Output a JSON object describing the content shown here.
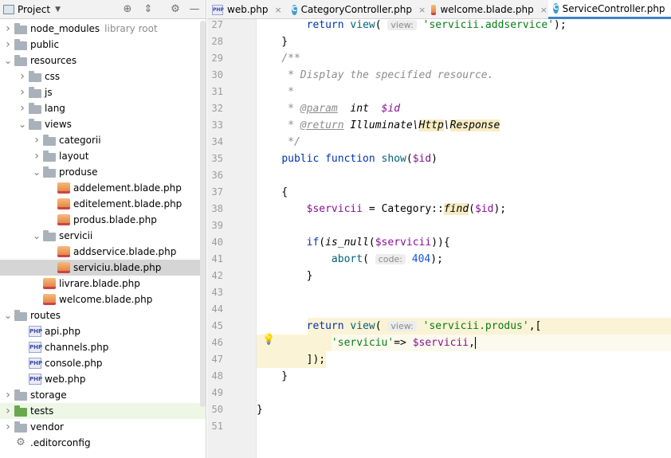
{
  "project_panel": {
    "title": "Project",
    "tree": [
      {
        "label": "node_modules",
        "suffix": "library root",
        "type": "folder",
        "depth": 1,
        "expanded": false
      },
      {
        "label": "public",
        "type": "folder",
        "depth": 1,
        "expanded": false
      },
      {
        "label": "resources",
        "type": "folder",
        "depth": 1,
        "expanded": true
      },
      {
        "label": "css",
        "type": "folder",
        "depth": 2,
        "expanded": false
      },
      {
        "label": "js",
        "type": "folder",
        "depth": 2,
        "expanded": false
      },
      {
        "label": "lang",
        "type": "folder",
        "depth": 2,
        "expanded": false
      },
      {
        "label": "views",
        "type": "folder",
        "depth": 2,
        "expanded": true
      },
      {
        "label": "categorii",
        "type": "folder",
        "depth": 3,
        "expanded": false
      },
      {
        "label": "layout",
        "type": "folder",
        "depth": 3,
        "expanded": false
      },
      {
        "label": "produse",
        "type": "folder",
        "depth": 3,
        "expanded": true
      },
      {
        "label": "addelement.blade.php",
        "type": "blade",
        "depth": 4
      },
      {
        "label": "editelement.blade.php",
        "type": "blade",
        "depth": 4
      },
      {
        "label": "produs.blade.php",
        "type": "blade",
        "depth": 4
      },
      {
        "label": "servicii",
        "type": "folder",
        "depth": 3,
        "expanded": true
      },
      {
        "label": "addservice.blade.php",
        "type": "blade",
        "depth": 4
      },
      {
        "label": "serviciu.blade.php",
        "type": "blade",
        "depth": 4,
        "selected": true
      },
      {
        "label": "livrare.blade.php",
        "type": "blade",
        "depth": 3
      },
      {
        "label": "welcome.blade.php",
        "type": "blade",
        "depth": 3
      },
      {
        "label": "routes",
        "type": "folder",
        "depth": 1,
        "expanded": true
      },
      {
        "label": "api.php",
        "type": "php",
        "depth": 2
      },
      {
        "label": "channels.php",
        "type": "php",
        "depth": 2
      },
      {
        "label": "console.php",
        "type": "php",
        "depth": 2
      },
      {
        "label": "web.php",
        "type": "php",
        "depth": 2
      },
      {
        "label": "storage",
        "type": "folder",
        "depth": 1,
        "expanded": false
      },
      {
        "label": "tests",
        "type": "folder-green",
        "depth": 1,
        "expanded": false
      },
      {
        "label": "vendor",
        "type": "folder",
        "depth": 1,
        "expanded": false
      },
      {
        "label": ".editorconfig",
        "type": "config",
        "depth": 1
      }
    ]
  },
  "tabs": [
    {
      "label": "web.php",
      "icon": "php-file-icon",
      "active": false
    },
    {
      "label": "CategoryController.php",
      "icon": "class-icon",
      "active": false
    },
    {
      "label": "welcome.blade.php",
      "icon": "blade-file-icon",
      "active": false
    },
    {
      "label": "ServiceController.php",
      "icon": "class-icon",
      "active": true
    }
  ],
  "editor": {
    "line_numbers": [
      "27",
      "28",
      "29",
      "30",
      "31",
      "32",
      "33",
      "34",
      "35",
      "36",
      "37",
      "38",
      "39",
      "40",
      "41",
      "42",
      "43",
      "44",
      "45",
      "46",
      "47",
      "48",
      "49",
      "50",
      "51"
    ],
    "param_hints": {
      "view": "view:",
      "code": "code:"
    },
    "strings": {
      "l27_tail": ");",
      "l27_str": "'servicii.addservice'",
      "l30": " * Display the specified resource.",
      "l31": " *",
      "l34": " */",
      "l38_str": "Category::",
      "l45_str": "'servicii.produs'",
      "l46_str": "'serviciu'",
      "l41_num": "404"
    }
  },
  "colors": {
    "keyword": "#0033b3",
    "string": "#067d17",
    "variable": "#871094",
    "comment": "#8c8c8c",
    "number": "#1750eb",
    "tab_active_underline": "#4083c9"
  }
}
